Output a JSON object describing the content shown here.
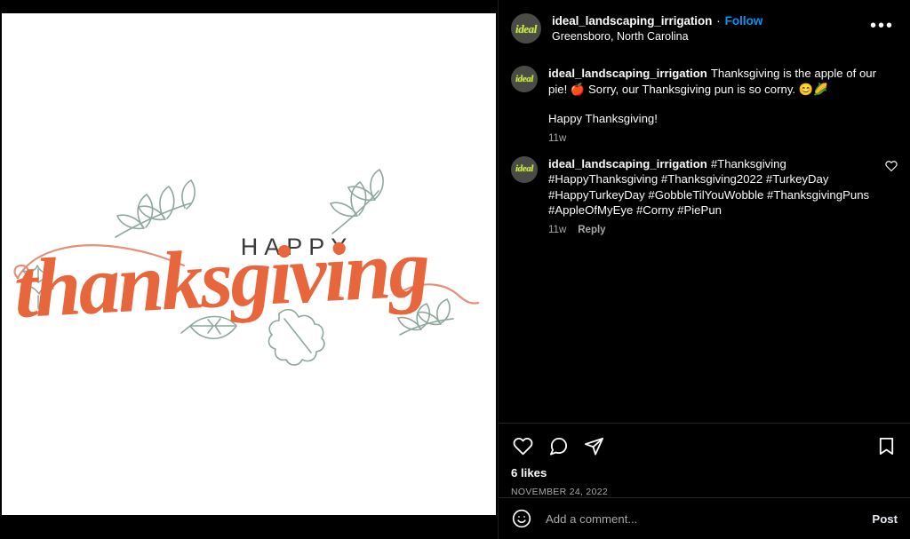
{
  "header": {
    "username": "ideal_landscaping_irrigation",
    "separator": "·",
    "follow_label": "Follow",
    "location": "Greensboro, North Carolina",
    "more_glyph": "•••",
    "avatar_text": "ideal"
  },
  "caption": {
    "username": "ideal_landscaping_irrigation",
    "text": "Thanksgiving is the apple of our pie! 🍎 Sorry, our Thanksgiving pun is so corny. 😊🌽",
    "second_line": "Happy Thanksgiving!",
    "time": "11w",
    "avatar_text": "ideal"
  },
  "comment": {
    "username": "ideal_landscaping_irrigation",
    "text": "#Thanksgiving #HappyThanksgiving #Thanksgiving2022 #TurkeyDay #HappyTurkeyDay #GobbleTilYouWobble #ThanksgivingPuns #AppleOfMyEye #Corny #PiePun",
    "time": "11w",
    "reply_label": "Reply",
    "avatar_text": "ideal"
  },
  "actions": {
    "like_icon": "heart-icon",
    "comment_icon": "comment-bubble-icon",
    "share_icon": "share-paper-plane-icon",
    "save_icon": "bookmark-icon"
  },
  "stats": {
    "likes": "6 likes",
    "date": "NOVEMBER 24, 2022"
  },
  "add_comment": {
    "placeholder": "Add a comment...",
    "value": "",
    "post_label": "Post",
    "emoji_icon": "smiley-face-icon"
  },
  "media": {
    "alt": "Happy Thanksgiving hand-lettered greeting with leaf illustrations",
    "word_happy": "HAPPY",
    "word_script": "thanksgiving",
    "script_color": "#E8663C",
    "leaf_color": "#8FA79C",
    "happy_color": "#3C3C3C",
    "background": "#FFFFFF"
  },
  "colors": {
    "page_background": "#000000",
    "accent_link": "#0095F6",
    "primary_text": "#FAFAFA",
    "secondary_text": "#A8A8A8",
    "divider": "#262626"
  }
}
